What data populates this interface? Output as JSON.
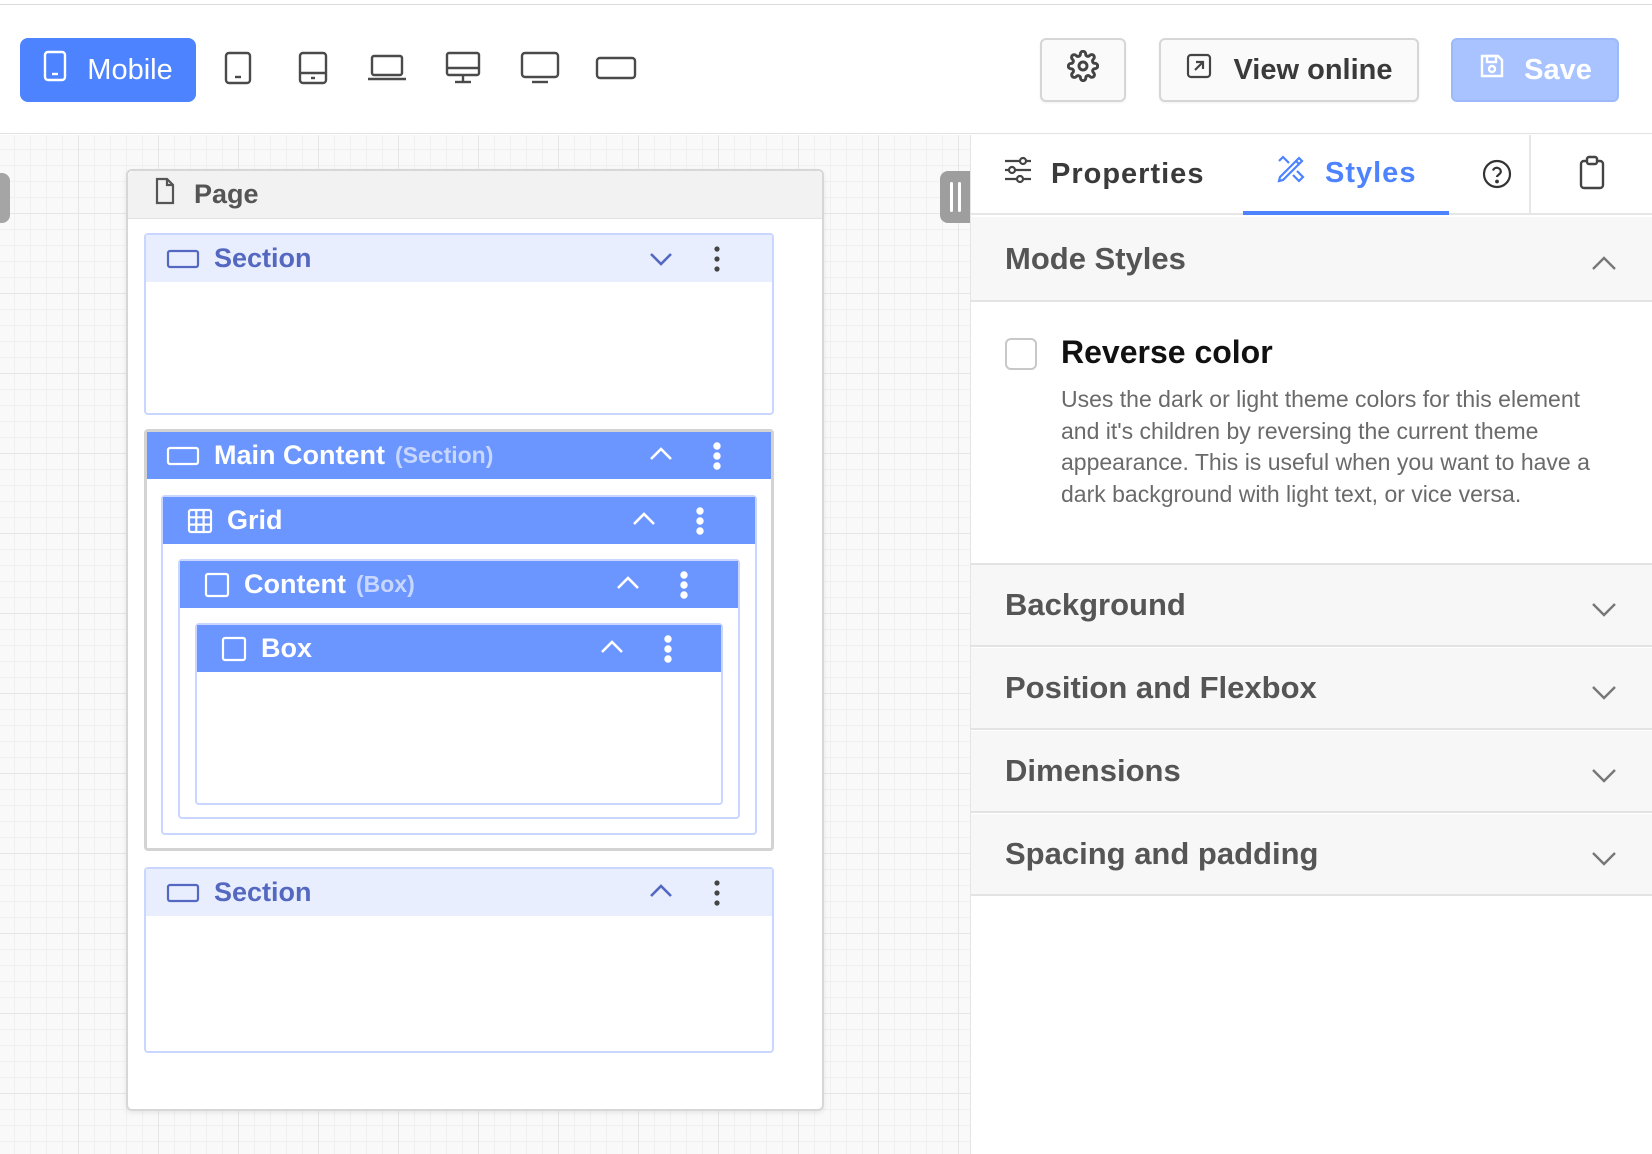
{
  "toolbar": {
    "device_active_label": "Mobile",
    "view_online_label": "View online",
    "save_label": "Save",
    "devices": [
      "mobile",
      "tablet-portrait",
      "tablet",
      "laptop",
      "desktop",
      "monitor",
      "widescreen"
    ]
  },
  "canvas": {
    "page_title": "Page",
    "blocks": {
      "section1": {
        "title": "Section",
        "expanded": false
      },
      "main": {
        "title": "Main Content",
        "sub": "(Section)",
        "expanded": true
      },
      "grid": {
        "title": "Grid",
        "expanded": true
      },
      "content": {
        "title": "Content",
        "sub": "(Box)",
        "expanded": true
      },
      "box": {
        "title": "Box",
        "expanded": true
      },
      "section2": {
        "title": "Section",
        "expanded": true
      }
    }
  },
  "panel": {
    "tabs": {
      "properties": "Properties",
      "styles": "Styles",
      "active": "Styles"
    },
    "sections": {
      "mode_styles": "Mode Styles",
      "background": "Background",
      "position_flexbox": "Position and Flexbox",
      "dimensions": "Dimensions",
      "spacing": "Spacing and padding"
    },
    "reverse_color": {
      "title": "Reverse color",
      "checked": false,
      "description": "Uses the dark or light theme colors for this element and it's children by reversing the current theme appearance. This is useful when you want to have a dark background with light text, or vice versa."
    }
  },
  "colors": {
    "accent": "#4d83ff",
    "accent_light": "#a8c3ff",
    "block_header": "#e8eefe",
    "block_text": "#5568c0",
    "selected_header": "#6b95ff"
  }
}
